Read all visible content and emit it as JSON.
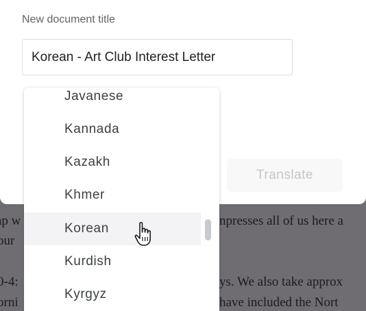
{
  "background_document": {
    "line1_left": "ap w",
    "line1_right": "npresses all of us here a",
    "line2_left": "our",
    "line3_left": "0-4:",
    "line3_right": "ys. We also take approx",
    "line4_left": "orni",
    "line4_right": "have included the Nort"
  },
  "dialog": {
    "field_label": "New document title",
    "title_value": "Korean - Art Club Interest Letter",
    "translate_label": "Translate"
  },
  "language_dropdown": {
    "options": [
      "Javanese",
      "Kannada",
      "Kazakh",
      "Khmer",
      "Korean",
      "Kurdish",
      "Kyrgyz"
    ],
    "hovered": "Korean"
  },
  "colors": {
    "overlay": "#6f6d72",
    "hover_row": "#f3f3f5",
    "disabled_text": "#c4c6ca"
  }
}
